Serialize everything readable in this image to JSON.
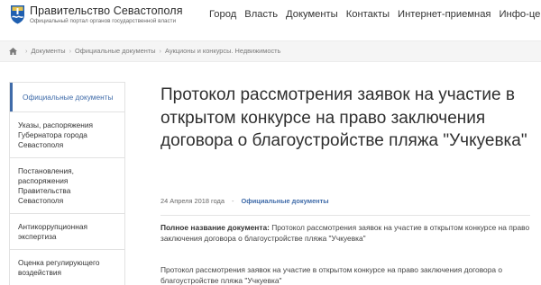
{
  "header": {
    "title": "Правительство Севастополя",
    "subtitle": "Официальный портал органов государственной власти",
    "nav": [
      "Город",
      "Власть",
      "Документы",
      "Контакты",
      "Интернет-приемная",
      "Инфо-центр"
    ]
  },
  "breadcrumb": [
    "Документы",
    "Официальные документы",
    "Аукционы и конкурсы. Недвижимость"
  ],
  "sidebar": {
    "items": [
      "Официальные документы",
      "Указы, распоряжения Губернатора города Севастополя",
      "Постановления, распоряжения Правительства Севастополя",
      "Антикоррупционная экспертиза",
      "Оценка регулирующего воздействия"
    ]
  },
  "article": {
    "title": "Протокол рассмотрения заявок на участие в открытом конкурсе на право заключения договора о благоустройстве пляжа \"Учкуевка\"",
    "date": "24 Апреля 2018 года",
    "dash": "-",
    "category": "Официальные документы",
    "full_name_label": "Полное название документа:",
    "full_name_value": " Протокол рассмотрения заявок на участие в открытом конкурсе на право заключения договора о благоустройстве пляжа \"Учкуевка\"",
    "body": "Протокол рассмотрения заявок на участие в открытом конкурсе на право заключения договора о благоустройстве пляжа \"Учкуевка\""
  },
  "colors": {
    "accent": "#3f6ba9",
    "crumb_bg": "#f5f5f5"
  },
  "icons": {
    "logo": "sevastopol-coat-of-arms",
    "home": "home-icon"
  }
}
